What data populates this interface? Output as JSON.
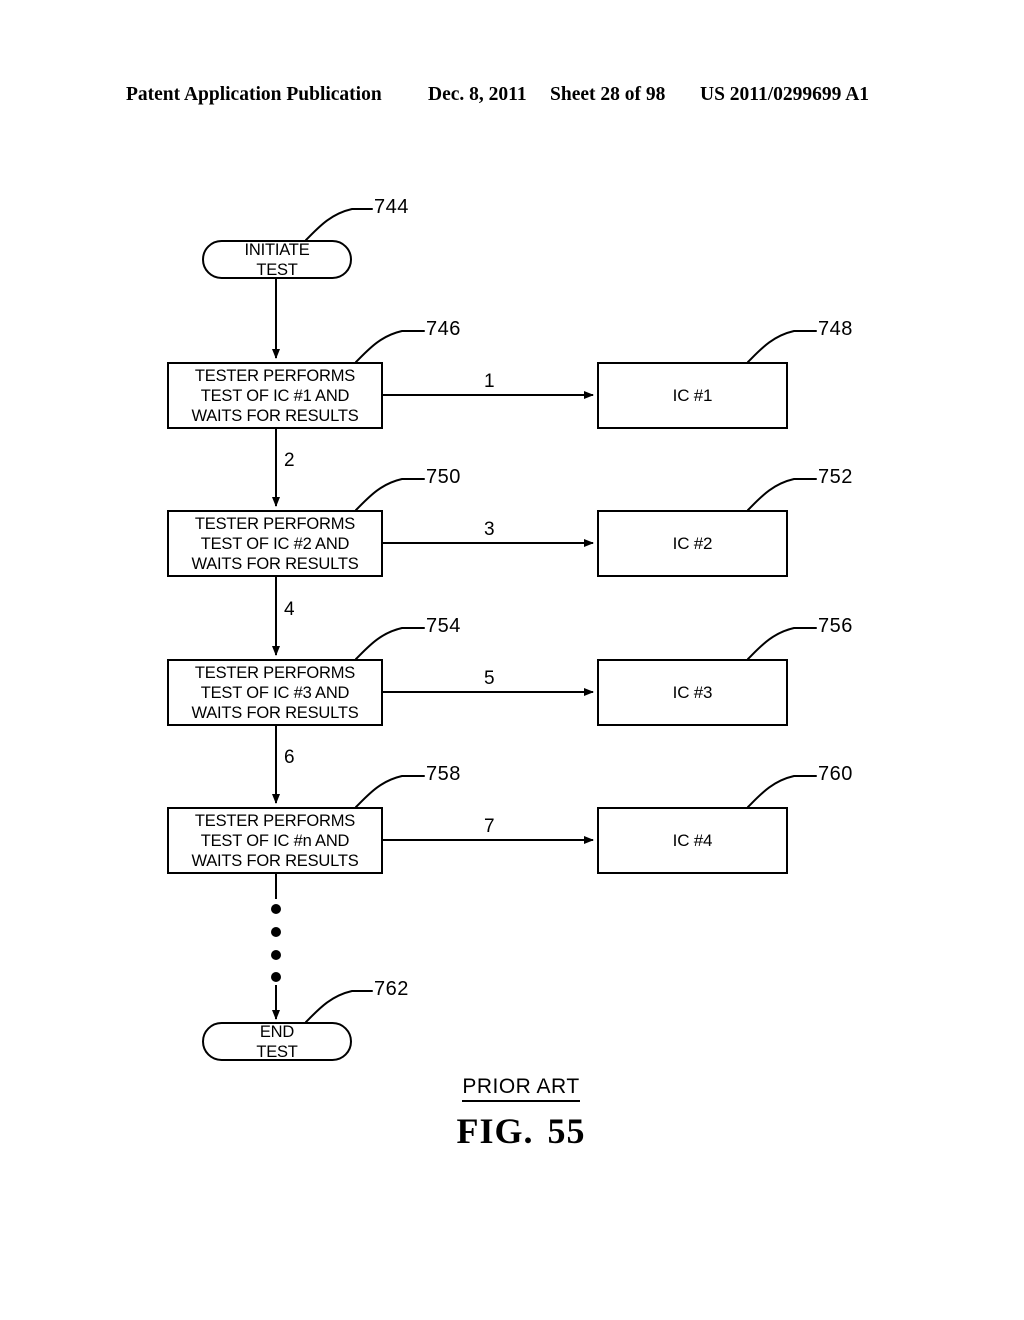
{
  "header": {
    "publication": "Patent Application Publication",
    "date": "Dec. 8, 2011",
    "sheet": "Sheet 28 of 98",
    "patent_number": "US 2011/0299699 A1"
  },
  "figure": {
    "caption_prior_art": "PRIOR ART",
    "caption_fig_word": "FIG.",
    "caption_fig_number": "55",
    "type": "flowchart",
    "dots_label": "vertical-ellipsis"
  },
  "nodes": {
    "start": {
      "ref": "744",
      "line1": "INITIATE",
      "line2": "TEST"
    },
    "end": {
      "ref": "762",
      "line1": "END",
      "line2": "TEST"
    },
    "steps": [
      {
        "ref": "746",
        "line1": "TESTER PERFORMS",
        "line2": "TEST OF IC #1 AND",
        "line3": "WAITS FOR RESULTS",
        "ic_ref": "748",
        "ic_label": "IC #1",
        "arrow_to_ic_label": "1",
        "arrow_to_next_label": "2"
      },
      {
        "ref": "750",
        "line1": "TESTER PERFORMS",
        "line2": "TEST OF IC #2 AND",
        "line3": "WAITS FOR RESULTS",
        "ic_ref": "752",
        "ic_label": "IC #2",
        "arrow_to_ic_label": "3",
        "arrow_to_next_label": "4"
      },
      {
        "ref": "754",
        "line1": "TESTER PERFORMS",
        "line2": "TEST OF IC #3 AND",
        "line3": "WAITS FOR RESULTS",
        "ic_ref": "756",
        "ic_label": "IC #3",
        "arrow_to_ic_label": "5",
        "arrow_to_next_label": "6"
      },
      {
        "ref": "758",
        "line1": "TESTER PERFORMS",
        "line2": "TEST OF IC #n AND",
        "line3": "WAITS FOR RESULTS",
        "ic_ref": "760",
        "ic_label": "IC #4",
        "arrow_to_ic_label": "7",
        "arrow_to_next_label": ""
      }
    ]
  },
  "colors": {
    "ink": "#000000",
    "paper": "#ffffff"
  }
}
